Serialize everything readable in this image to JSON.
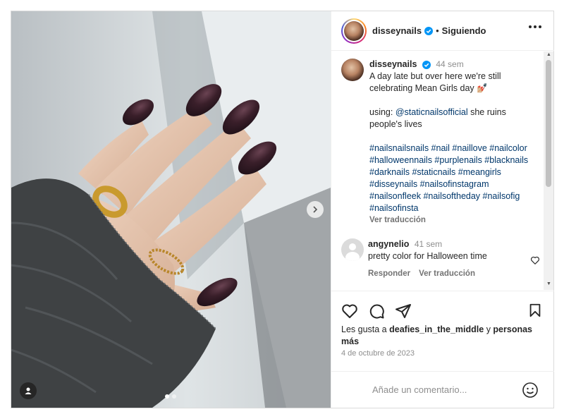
{
  "post": {
    "username": "disseynails",
    "separator": "•",
    "follow_status": "Siguiendo",
    "caption": {
      "username": "disseynails",
      "time": "44 sem",
      "line1": "A day late but over here we're still celebrating Mean Girls day 💅🏼",
      "using_label": "using:",
      "mention": "@staticnailsofficial",
      "using_rest": "she ruins people's lives",
      "hashtags": "#nailsnailsnails #nail #naillove #nailcolor #halloweennails #purplenails #blacknails #darknails #staticnails #meangirls #disseynails #nailsofinstagram #nailsonfleek #nailsoftheday #nailsofig #nailsofinsta",
      "translate": "Ver traducción"
    },
    "comments": [
      {
        "username": "angynelio",
        "time": "41 sem",
        "text": "pretty color for Halloween time",
        "reply": "Responder",
        "translate": "Ver traducción"
      }
    ],
    "likes": {
      "prefix": "Les gusta a",
      "user": "deafies_in_the_middle",
      "connector": "y",
      "others": "personas más"
    },
    "date": "4 de octubre de 2023",
    "add_comment_placeholder": "Añade un comentario...",
    "carousel": {
      "current": 1,
      "total": 2
    }
  },
  "icons": {
    "verified": "verified-badge-icon",
    "more": "more-options-icon",
    "like": "heart-icon",
    "comment": "comment-icon",
    "share": "share-icon",
    "save": "bookmark-icon",
    "emoji": "emoji-icon",
    "next": "chevron-right-icon",
    "tag": "user-tag-icon"
  },
  "colors": {
    "link": "#00376b",
    "verified": "#0095f6",
    "muted": "#8e8e8e",
    "nail_polish": "#3a1f2a"
  }
}
